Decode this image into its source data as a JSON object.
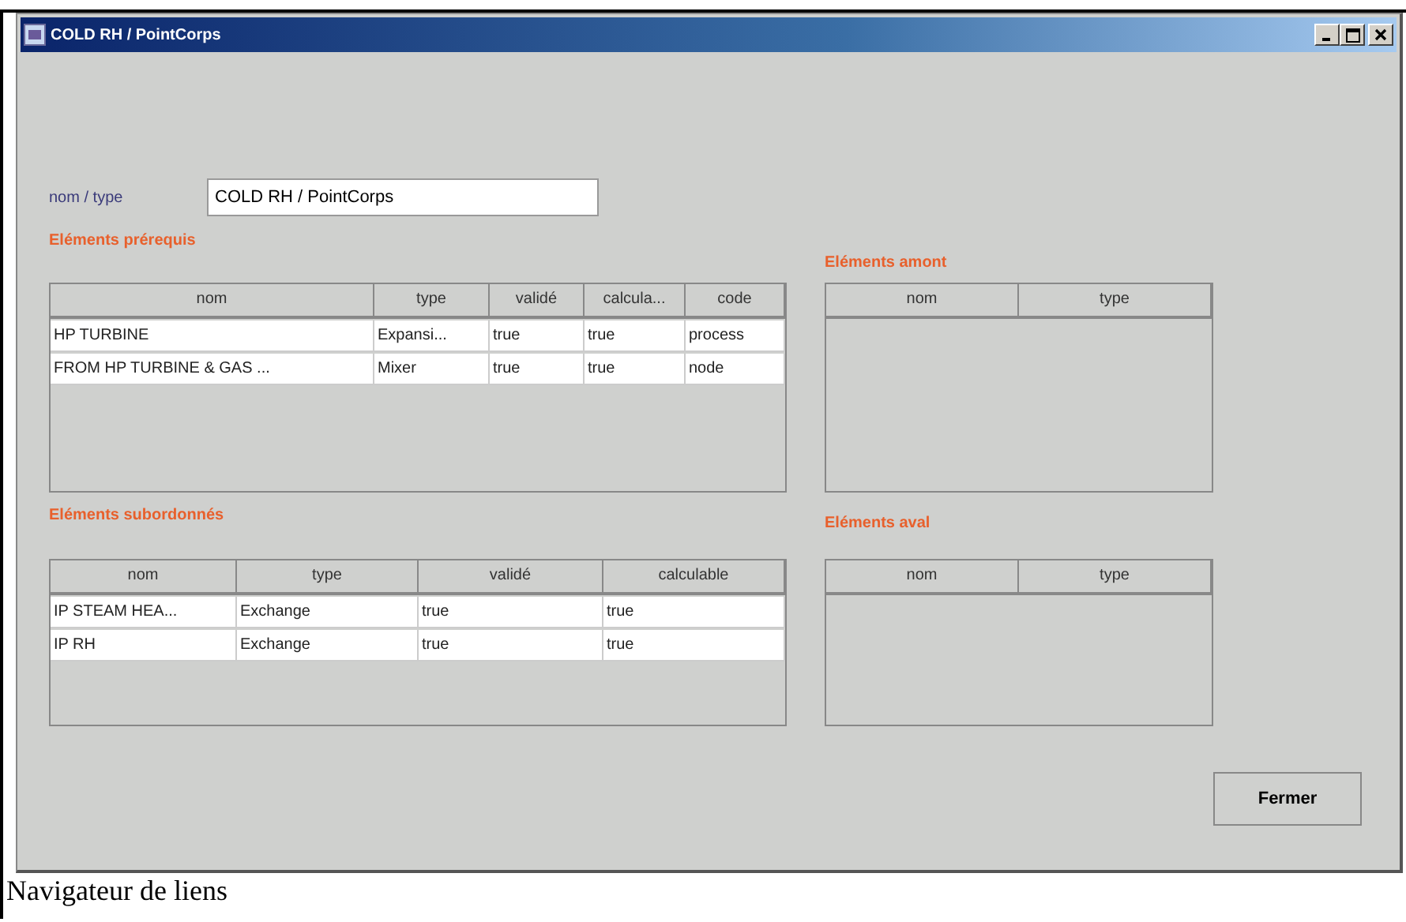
{
  "window": {
    "title": "COLD RH / PointCorps"
  },
  "name_type": {
    "label": "nom / type",
    "value": "COLD RH / PointCorps"
  },
  "panels": [
    {
      "title": "Eléments prérequis",
      "columns": [
        "nom",
        "type",
        "validé",
        "calcula...",
        "code"
      ],
      "rows": [
        [
          "HP TURBINE",
          "Expansi...",
          "true",
          "true",
          "process"
        ],
        [
          "FROM HP TURBINE & GAS ...",
          "Mixer",
          "true",
          "true",
          "node"
        ]
      ]
    },
    {
      "title": "Eléments amont",
      "columns": [
        "nom",
        "type"
      ]
    },
    {
      "title": "Eléments subordonnés",
      "columns": [
        "nom",
        "type",
        "validé",
        "calculable"
      ],
      "rows": [
        [
          "IP STEAM HEA...",
          "Exchange",
          "true",
          "true"
        ],
        [
          "IP RH",
          "Exchange",
          "true",
          "true"
        ]
      ]
    },
    {
      "title": "Eléments aval",
      "columns": [
        "nom",
        "type"
      ]
    }
  ],
  "buttons": [
    "Fermer"
  ],
  "caption": "Navigateur de liens"
}
